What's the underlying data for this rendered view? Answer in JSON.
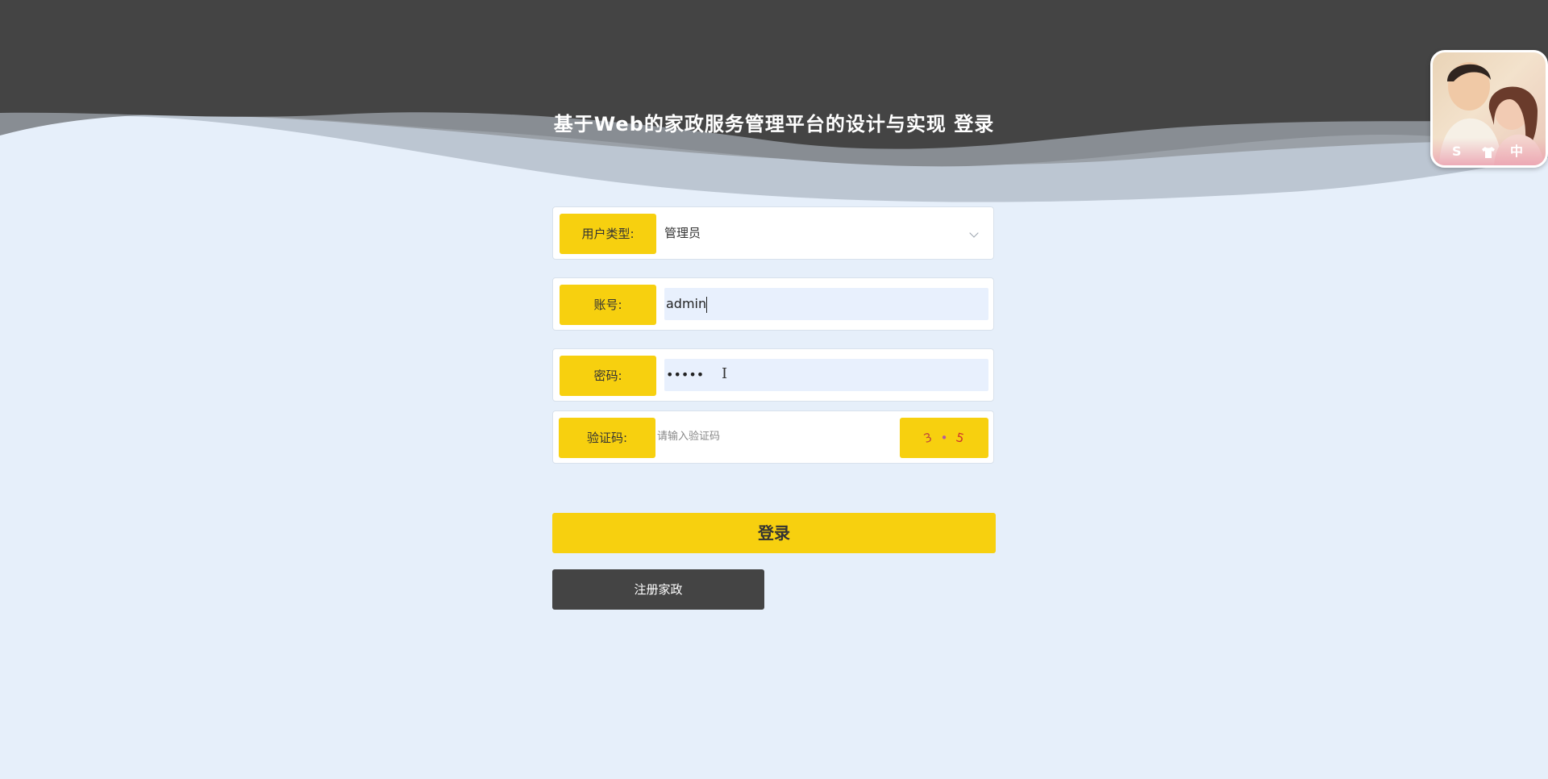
{
  "page": {
    "title": "基于Web的家政服务管理平台的设计与实现 登录"
  },
  "form": {
    "user_type": {
      "label": "用户类型:",
      "value": "管理员"
    },
    "account": {
      "label": "账号:",
      "value": "admin"
    },
    "password": {
      "label": "密码:",
      "value": "•••••"
    },
    "captcha": {
      "label": "验证码:",
      "placeholder": "请输入验证码",
      "code": [
        "3",
        "•",
        "5"
      ]
    },
    "login_label": "登录",
    "register_label": "注册家政"
  },
  "widget": {
    "icons": [
      "s-logo-icon",
      "shirt-icon",
      "chinese-input-icon"
    ],
    "glyphs": [
      "S",
      "中"
    ]
  },
  "colors": {
    "accent": "#f7d00f",
    "header": "#444444",
    "background": "#e6effa"
  }
}
